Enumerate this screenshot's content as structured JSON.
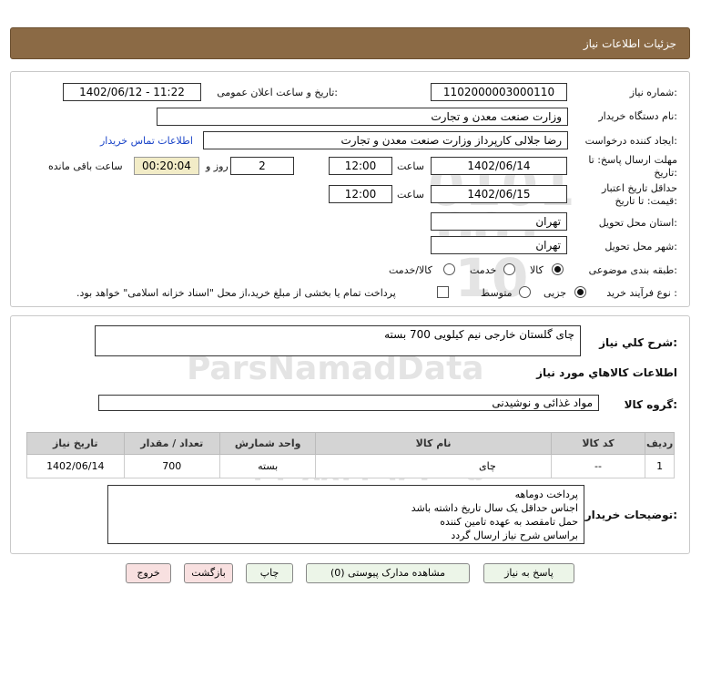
{
  "header": {
    "title": "جزئیات اطلاعات نیاز"
  },
  "form": {
    "need_number_label": "شماره نیاز:",
    "need_number": "1102000003000110",
    "announce_label": "تاریخ و ساعت اعلان عمومی:",
    "announce_value": "1402/06/12 - 11:22",
    "buyer_org_label": "نام دستگاه خریدار:",
    "buyer_org": "وزارت صنعت معدن و تجارت",
    "requester_label": "ایجاد کننده درخواست:",
    "requester": "رضا جلالی کارپرداز وزارت صنعت معدن و تجارت",
    "contact_link": "اطلاعات تماس خریدار",
    "reply_deadline_label": "مهلت ارسال پاسخ: تا تاریخ:",
    "reply_date": "1402/06/14",
    "time_label": "ساعت",
    "reply_time": "12:00",
    "days_value": "2",
    "days_label": "روز و",
    "remaining_time": "00:20:04",
    "remaining_label": "ساعت باقی مانده",
    "validity_label": "حداقل تاریخ اعتبار قیمت: تا تاریخ:",
    "validity_date": "1402/06/15",
    "validity_time": "12:00",
    "province_label": "استان محل تحویل:",
    "province": "تهران",
    "city_label": "شهر محل تحویل:",
    "city": "تهران",
    "category_label": "طبقه بندی موضوعی:",
    "category_options": [
      "کالا",
      "خدمت",
      "کالا/خدمت"
    ],
    "process_label": "نوع فرآیند خرید :",
    "process_options": [
      "جزیی",
      "متوسط"
    ],
    "payment_note": "پرداخت تمام یا بخشی از مبلغ خرید،از محل \"اسناد خزانه اسلامی\" خواهد بود."
  },
  "details": {
    "summary_label": "شرح کلي نياز:",
    "summary": "چای گلستان خارجی نیم کیلویی 700 بسته",
    "items_title": "اطلاعات کالاهاي مورد نياز",
    "group_label": "گروه کالا:",
    "group": "مواد غذائی و نوشیدنی",
    "table": {
      "headers": [
        "ردیف",
        "کد کالا",
        "نام کالا",
        "واحد شمارش",
        "تعداد / مقدار",
        "تاریخ نیاز"
      ],
      "rows": [
        [
          "1",
          "--",
          "چای",
          "بسته",
          "700",
          "1402/06/14"
        ]
      ]
    },
    "buyer_notes_label": "توضیحات خریدار:",
    "buyer_notes": [
      "پرداخت دوماهه",
      "اجناس حداقل یک سال تاریخ داشته باشد",
      "حمل تامقصد به عهده تامین کننده",
      "براساس شرح نیاز ارسال گردد"
    ]
  },
  "buttons": {
    "reply": "پاسخ به نیاز",
    "attachments": "مشاهده مدارک پیوستی (0)",
    "print": "چاپ",
    "back": "بازگشت",
    "exit": "خروج"
  }
}
